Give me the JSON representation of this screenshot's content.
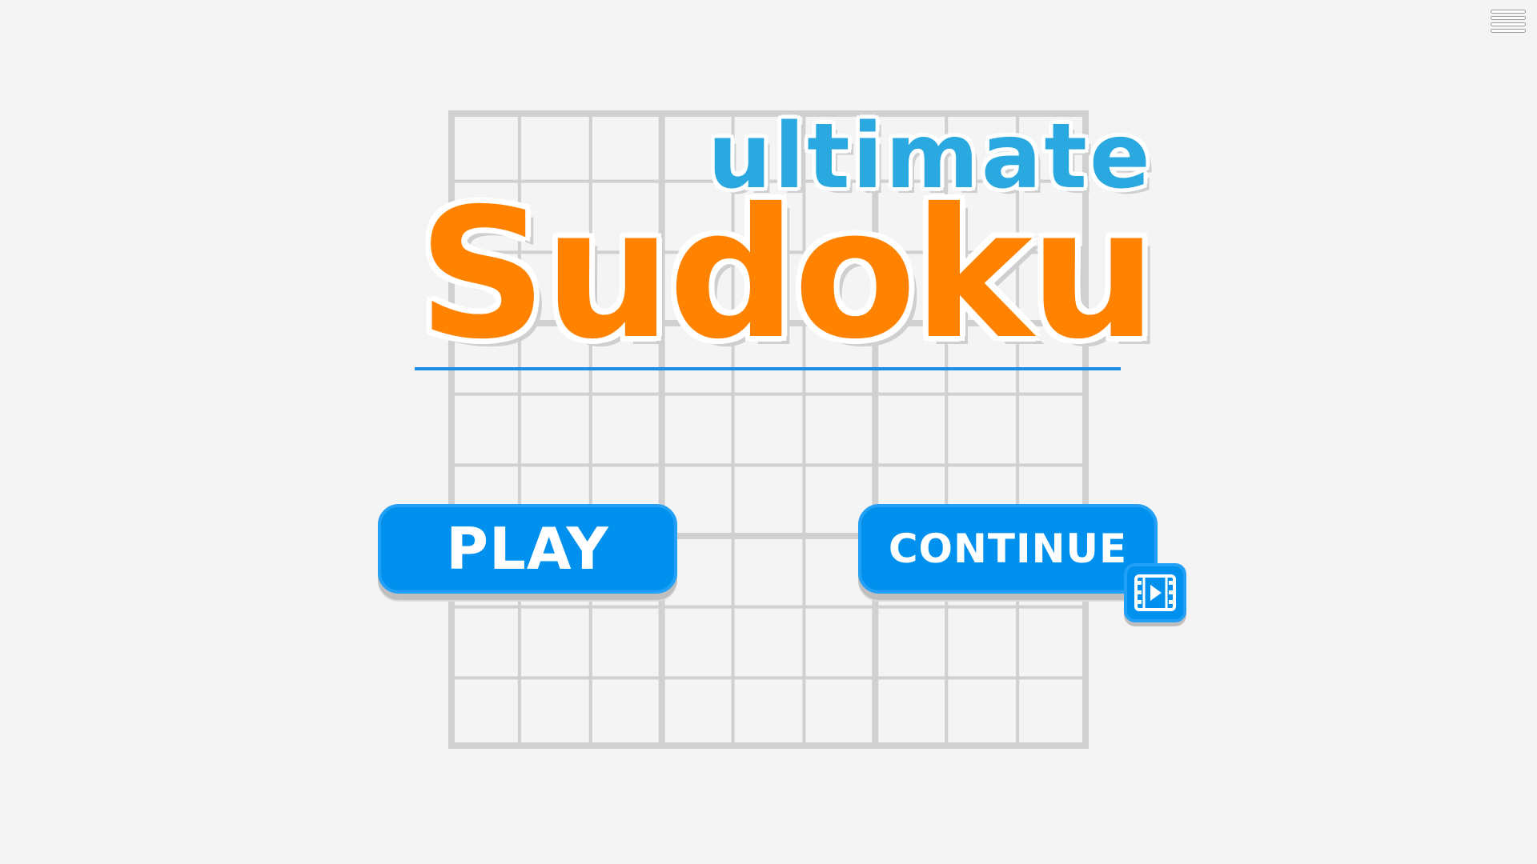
{
  "title": {
    "line1": "ultimate",
    "line2": "Sudoku"
  },
  "buttons": {
    "play_label": "PLAY",
    "continue_label": "CONTINUE"
  },
  "icons": {
    "menu": "hamburger-menu-icon",
    "video_ad": "film-play-icon"
  },
  "colors": {
    "background": "#f4f4f4",
    "grid_line": "#d0d0d0",
    "title_blue": "#29a9e0",
    "title_orange": "#ff8300",
    "button_blue": "#0090ee"
  }
}
